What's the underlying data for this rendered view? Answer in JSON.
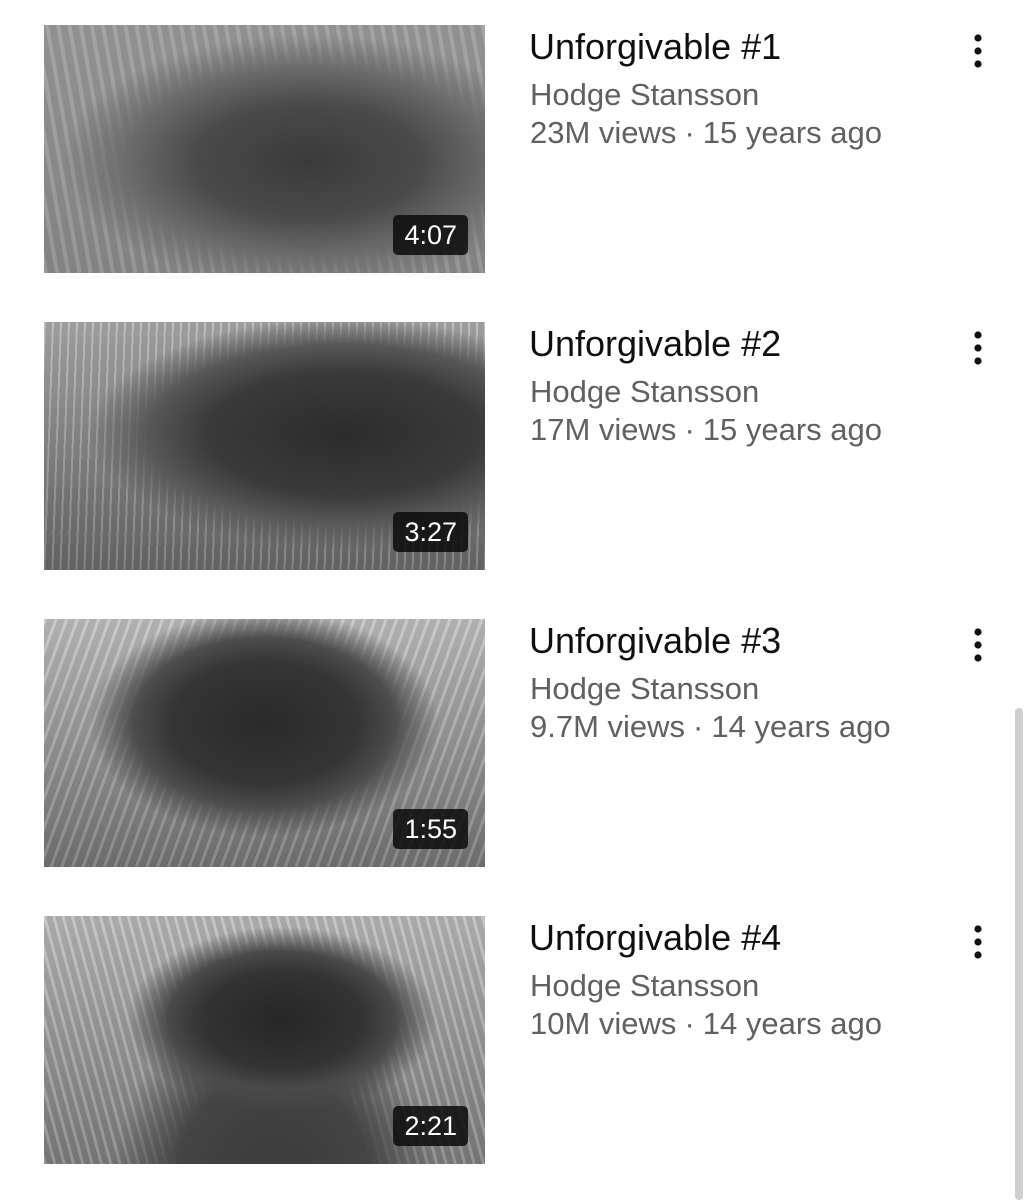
{
  "videos": [
    {
      "title": "Unforgivable #1",
      "channel": "Hodge Stansson",
      "views": "23M views",
      "age": "15 years ago",
      "duration": "4:07",
      "menu_icon": "more-vert-icon"
    },
    {
      "title": "Unforgivable #2",
      "channel": "Hodge Stansson",
      "views": "17M views",
      "age": "15 years ago",
      "duration": "3:27",
      "menu_icon": "more-vert-icon"
    },
    {
      "title": "Unforgivable #3",
      "channel": "Hodge Stansson",
      "views": "9.7M views",
      "age": "14 years ago",
      "duration": "1:55",
      "menu_icon": "more-vert-icon"
    },
    {
      "title": "Unforgivable #4",
      "channel": "Hodge Stansson",
      "views": "10M views",
      "age": "14 years ago",
      "duration": "2:21",
      "menu_icon": "more-vert-icon"
    }
  ],
  "meta_separator": "·",
  "colors": {
    "title": "#0f0f0f",
    "secondary_text": "#606060",
    "duration_badge_bg": "#0c0c0c",
    "duration_badge_text": "#ffffff",
    "scrollbar": "#cfcfcf"
  }
}
